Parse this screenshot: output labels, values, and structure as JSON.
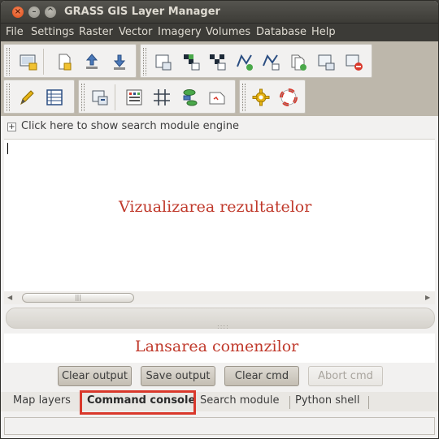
{
  "window": {
    "title": "GRASS GIS Layer Manager"
  },
  "menu": [
    "File",
    "Settings",
    "Raster",
    "Vector",
    "Imagery",
    "Volumes",
    "Database",
    "Help"
  ],
  "toolbar1": {
    "icons": [
      "new-display-icon",
      "new-workspace-icon",
      "load-workspace-icon",
      "import-icon"
    ]
  },
  "toolbar2": {
    "icons": [
      "add-raster-icon",
      "add-raster-misc-icon",
      "add-raster-overlay-icon",
      "add-vector-icon",
      "add-vector-misc-icon",
      "add-group-icon",
      "add-overlay-icon",
      "remove-layer-icon"
    ]
  },
  "toolbar3": {
    "icons": [
      "digitize-icon",
      "attribute-table-icon"
    ]
  },
  "toolbar4": {
    "icons": [
      "georectify-icon",
      "calculator-icon",
      "grid-icon",
      "modeler-icon",
      "nviz-icon"
    ]
  },
  "toolbar5": {
    "icons": [
      "settings-icon",
      "help-icon"
    ]
  },
  "search": {
    "toggle_label": "Click here to show search module engine"
  },
  "output": {
    "annotation": "Vizualizarea rezultatelor"
  },
  "command": {
    "annotation": "Lansarea comenzilor"
  },
  "buttons": {
    "clear_output": "Clear output",
    "save_output": "Save output",
    "clear_cmd": "Clear cmd",
    "abort_cmd": "Abort cmd"
  },
  "tabs": [
    "Map layers",
    "Command console",
    "Search module",
    "Python shell"
  ],
  "active_tab": "Command console",
  "colors": {
    "annotation": "#c0392b",
    "highlight": "#d9382b",
    "titlebar": "#3c3b37"
  }
}
